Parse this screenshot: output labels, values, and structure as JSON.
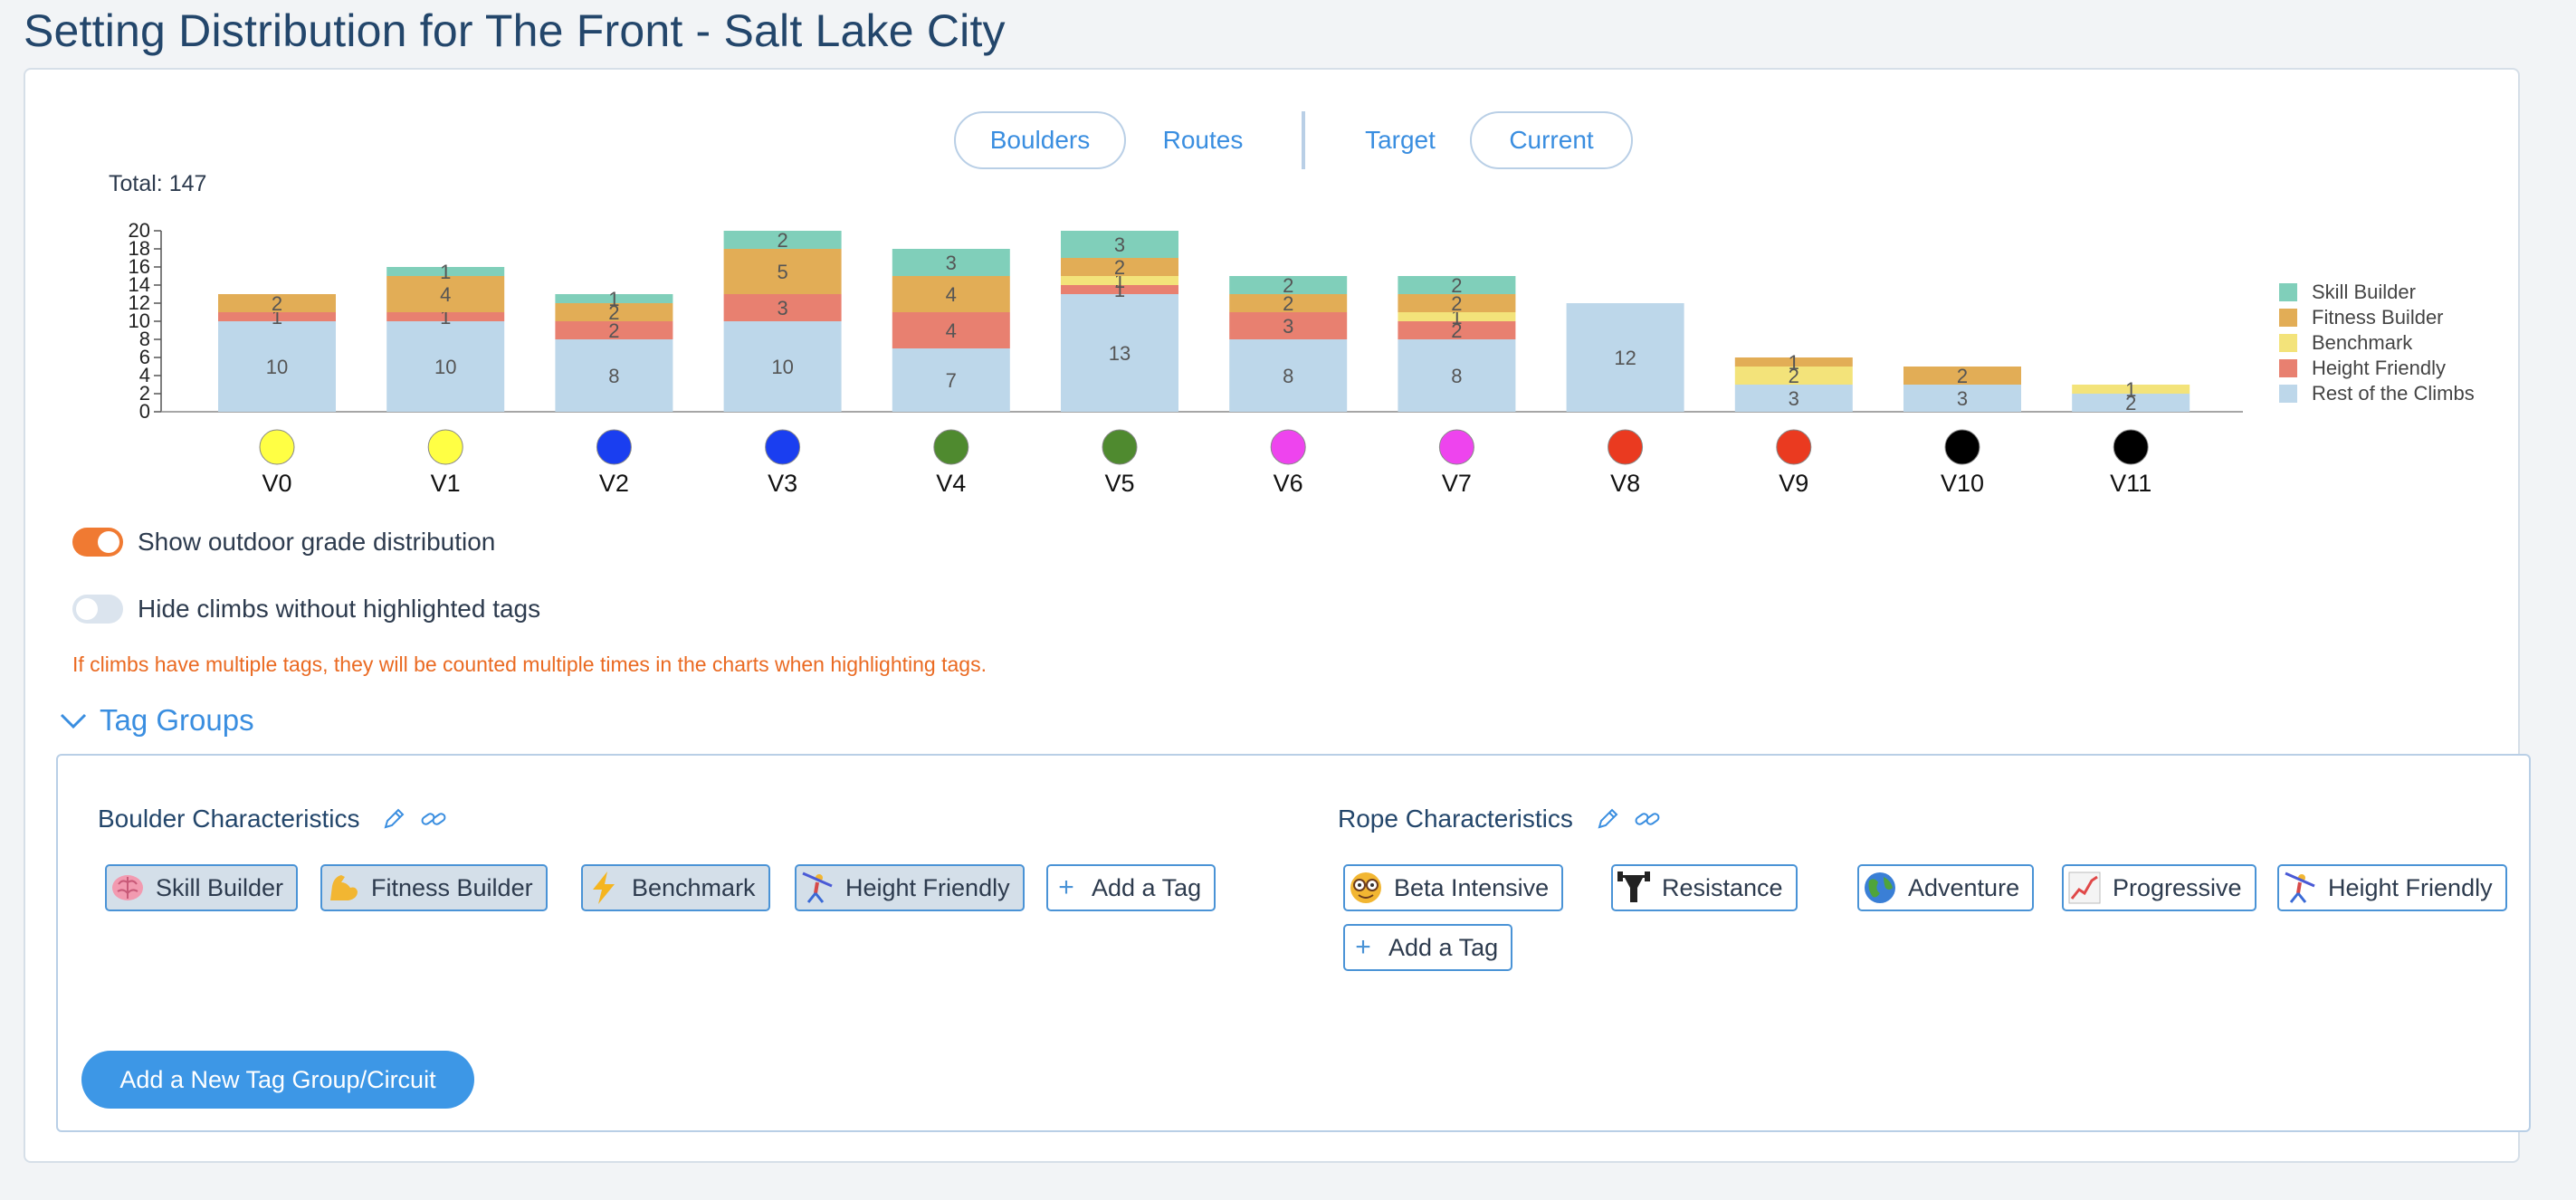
{
  "page": {
    "title": "Setting Distribution for The Front - Salt Lake City"
  },
  "toggle_bar": {
    "boulders": "Boulders",
    "routes": "Routes",
    "target": "Target",
    "current": "Current"
  },
  "chart_data": {
    "type": "bar",
    "stacked": true,
    "total_label": "Total: 147",
    "categories": [
      "V0",
      "V1",
      "V2",
      "V3",
      "V4",
      "V5",
      "V6",
      "V7",
      "V8",
      "V9",
      "V10",
      "V11"
    ],
    "grade_colors": [
      "#ffff44",
      "#ffff44",
      "#1a3ef0",
      "#1a3ef0",
      "#4f8a2f",
      "#4f8a2f",
      "#ee44ee",
      "#ee44ee",
      "#ea3a20",
      "#ea3a20",
      "#000000",
      "#000000"
    ],
    "ylim": [
      0,
      20
    ],
    "yticks": [
      0,
      2,
      4,
      6,
      8,
      10,
      12,
      14,
      16,
      18,
      20
    ],
    "legend_position": "right",
    "series": [
      {
        "name": "Rest of the Climbs",
        "color": "#bdd7ea",
        "values": [
          10,
          10,
          8,
          10,
          7,
          13,
          8,
          8,
          12,
          3,
          3,
          2
        ]
      },
      {
        "name": "Height Friendly",
        "color": "#e88070",
        "values": [
          1,
          1,
          2,
          3,
          4,
          1,
          3,
          2,
          0,
          0,
          0,
          0
        ]
      },
      {
        "name": "Benchmark",
        "color": "#f3e37a",
        "values": [
          0,
          0,
          0,
          0,
          0,
          1,
          0,
          1,
          0,
          2,
          0,
          1
        ]
      },
      {
        "name": "Fitness Builder",
        "color": "#e2ad56",
        "values": [
          2,
          4,
          2,
          5,
          4,
          2,
          2,
          2,
          0,
          1,
          2,
          0
        ]
      },
      {
        "name": "Skill Builder",
        "color": "#80cfba",
        "values": [
          0,
          1,
          1,
          2,
          3,
          3,
          2,
          2,
          0,
          0,
          0,
          0
        ]
      }
    ],
    "legend_order": [
      "Skill Builder",
      "Fitness Builder",
      "Benchmark",
      "Height Friendly",
      "Rest of the Climbs"
    ]
  },
  "options": {
    "outdoor_label": "Show outdoor grade distribution",
    "outdoor_on": true,
    "hide_label": "Hide climbs without highlighted tags",
    "hide_on": false,
    "warning": "If climbs have multiple tags, they will be counted multiple times in the charts when highlighting tags."
  },
  "tag_groups": {
    "title": "Tag Groups",
    "boulder": {
      "title": "Boulder Characteristics",
      "tags": [
        "Skill Builder",
        "Fitness Builder",
        "Benchmark",
        "Height Friendly"
      ],
      "add_label": "Add a Tag"
    },
    "rope": {
      "title": "Rope Characteristics",
      "tags": [
        "Beta Intensive",
        "Resistance",
        "Adventure",
        "Progressive",
        "Height Friendly"
      ],
      "add_label": "Add a Tag"
    },
    "add_group_label": "Add a New Tag Group/Circuit"
  },
  "icons": {
    "skill_builder": "brain-icon",
    "fitness_builder": "flexed-biceps-icon",
    "benchmark": "lightning-icon",
    "height_friendly": "stretching-climber-icon",
    "beta_intensive": "nerd-face-icon",
    "resistance": "weightlifter-icon",
    "adventure": "globe-icon",
    "progressive": "chart-increasing-icon"
  }
}
